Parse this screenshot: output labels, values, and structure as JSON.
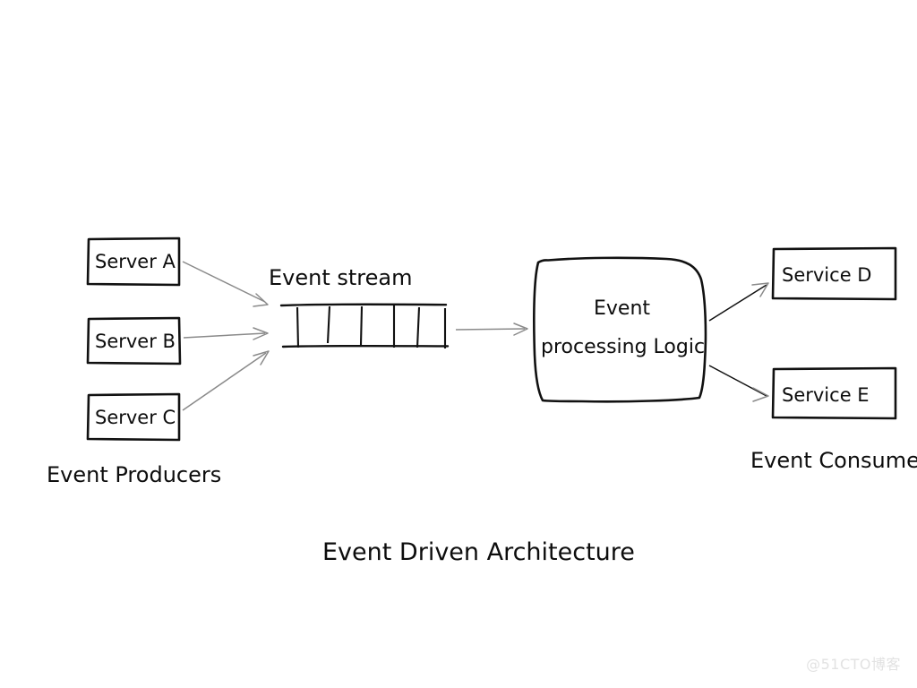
{
  "diagram": {
    "title": "Event Driven Architecture",
    "watermark": "@51CTO博客",
    "producers": {
      "group_label": "Event  Producers",
      "boxes": [
        {
          "label": "Server A"
        },
        {
          "label": "Server B"
        },
        {
          "label": "Server C"
        }
      ]
    },
    "stream": {
      "label": "Event  stream",
      "segments": 6
    },
    "processor": {
      "label_line1": "Event",
      "label_line2": "processing Logic"
    },
    "consumers": {
      "group_label": "Event Consumers",
      "boxes": [
        {
          "label": "Service D"
        },
        {
          "label": "Service E"
        }
      ]
    },
    "colors": {
      "ink": "#111111",
      "arrow": "#8a8a8a",
      "background": "#ffffff",
      "watermark": "#e2e2e2"
    }
  }
}
